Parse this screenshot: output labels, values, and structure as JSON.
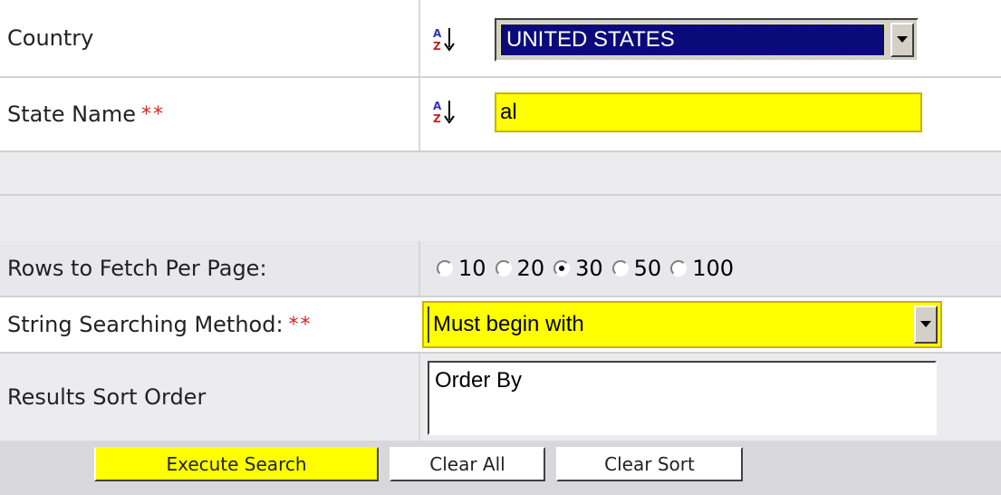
{
  "form": {
    "country": {
      "label": "Country",
      "value": "UNITED STATES"
    },
    "state": {
      "label": "State Name",
      "required_mark": "**",
      "value": "al"
    },
    "rows_per_page": {
      "label": "Rows to Fetch Per Page:",
      "options": [
        "10",
        "20",
        "30",
        "50",
        "100"
      ],
      "selected": "30"
    },
    "search_method": {
      "label": "String Searching Method:",
      "required_mark": "**",
      "value": "Must begin with"
    },
    "sort_order": {
      "label": "Results Sort Order",
      "value": "Order By"
    }
  },
  "buttons": {
    "execute": "Execute Search",
    "clear_all": "Clear All",
    "clear_sort": "Clear Sort"
  },
  "icons": {
    "sort": "sort-az-icon",
    "dropdown": "chevron-down-icon"
  },
  "colors": {
    "highlight_yellow": "#ffff00",
    "selected_navy": "#0a0a7a",
    "row_gray": "#ececef",
    "footer_gray": "#d8d8dc",
    "required_red": "#e02020"
  }
}
